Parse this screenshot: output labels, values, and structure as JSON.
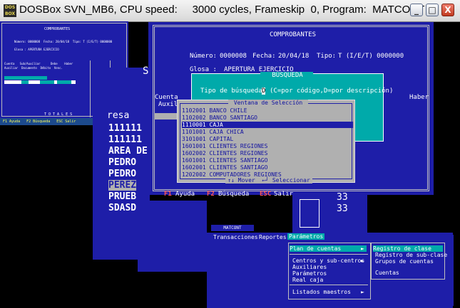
{
  "window": {
    "app_icon_text": "DOS BOX",
    "title": "DOSBox SVN_MB6, CPU speed:     3000 cycles, Frameskip  0, Program:  MATCONT",
    "minimize_glyph": "_",
    "maximize_glyph": "□",
    "close_glyph": "X"
  },
  "small_window": {
    "title": "COMPROBANTES",
    "line1": "Número: 0000008  Fecha: 20/04/18  Tipo: T (I/E/T) 0000000",
    "line2": "Glosa : APERTURA EJERCICIO",
    "col_headers": "Cuenta   Sub/Auxiliar      Debe    Haber",
    "col_headers2": "Auxiliar  Documento  Débito  Venc.",
    "totals_label": "T O T A L E S",
    "footer": "F1 Ayuda   F2 Búsqueda   ESC Salir"
  },
  "comprobantes": {
    "title": "COMPROBANTES",
    "numero_label": "Número:",
    "numero": "0000008",
    "fecha_label": "Fecha:",
    "fecha": "20/04/18",
    "tipo_label": "Tipo:",
    "tipo": "T (I/E/T) 0000000",
    "glosa_label": "Glosa :",
    "glosa": "APERTURA EJERCICIO",
    "cuenta_label": "Cuenta",
    "auxil_label": "Auxil",
    "haber_label": "Haber",
    "footer_f1_key": "F1",
    "footer_f1": "Ayuda",
    "footer_f2_key": "F2",
    "footer_f2": "Búsqueda",
    "footer_esc_key": "ESC",
    "footer_esc": "Salir",
    "right_numbers": [
      "33",
      "33"
    ]
  },
  "busqueda": {
    "title": "BÚSQUEDA",
    "prompt": "Tipo de búsqueda:",
    "value": "D",
    "hint": "(C=por código,D=por descripción)"
  },
  "seleccion": {
    "title": "Ventana de Selección",
    "rows": [
      {
        "code": "1102001",
        "name": "BANCO CHILE"
      },
      {
        "code": "1102002",
        "name": "BANCO SANTIAGO"
      },
      {
        "code": "1110001",
        "name": "CAJA"
      },
      {
        "code": "1101001",
        "name": "CAJA CHICA"
      },
      {
        "code": "3101001",
        "name": "CAPITAL"
      },
      {
        "code": "1601001",
        "name": "CLIENTES REGIONES"
      },
      {
        "code": "1602002",
        "name": "CLIENTES REGIONES"
      },
      {
        "code": "1601001",
        "name": "CLIENTES SANTIAGO"
      },
      {
        "code": "1602001",
        "name": "CLIENTES SANTIAGO"
      },
      {
        "code": "1202002",
        "name": "COMPUTADORES REGIONES"
      }
    ],
    "selected_index": 2,
    "footer": "↑↓ Mover  ←┘ Seleccionar"
  },
  "behind_list": {
    "partial_label": "resa",
    "letter": "S",
    "names": [
      "111111",
      "111111",
      "AREA DE",
      "PEDRO",
      "PEDRO",
      "PEREZ",
      "PRUEB",
      "SDASD"
    ]
  },
  "menu": {
    "badge": "MATCONT",
    "items": [
      "Transacciones",
      "Reportes",
      "Parámetros"
    ],
    "active_item": "Parámetros",
    "submenu": [
      {
        "label": "Plan de cuentas",
        "arrow": "►"
      },
      {
        "label": "Centros y sub-centros",
        "arrow": "►"
      },
      {
        "label": "Auxiliares",
        "arrow": ""
      },
      {
        "label": "Parámetros",
        "arrow": ""
      },
      {
        "label": "Real caja",
        "arrow": ""
      },
      {
        "label": "Listados maestros",
        "arrow": "►"
      }
    ],
    "submenu2": [
      "Registro de clase",
      "Registro de sub-clase",
      "Grupos de cuentas",
      "Cuentas"
    ]
  },
  "colors": {
    "dos_blue": "#1e1ea8",
    "dos_cyan": "#00aaaa",
    "dos_gray": "#b0b0b0",
    "dos_red": "#e02020",
    "dos_yellow": "#ffff55"
  }
}
